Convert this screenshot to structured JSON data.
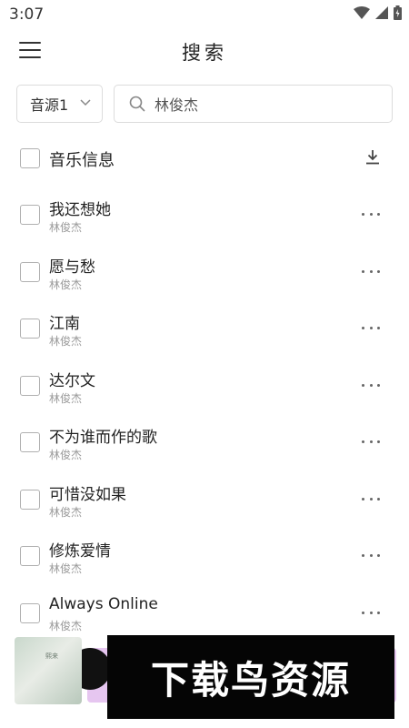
{
  "status_bar": {
    "time": "3:07"
  },
  "header": {
    "title": "搜索"
  },
  "search": {
    "source_label": "音源1",
    "query": "林俊杰"
  },
  "list_header": {
    "label": "音乐信息"
  },
  "songs": [
    {
      "title": "我还想她",
      "artist": "林俊杰"
    },
    {
      "title": "愿与愁",
      "artist": "林俊杰"
    },
    {
      "title": "江南",
      "artist": "林俊杰"
    },
    {
      "title": "达尔文",
      "artist": "林俊杰"
    },
    {
      "title": "不为谁而作的歌",
      "artist": "林俊杰"
    },
    {
      "title": "可惜没如果",
      "artist": "林俊杰"
    },
    {
      "title": "修炼爱情",
      "artist": "林俊杰"
    },
    {
      "title": "Always Online",
      "artist": "林俊杰"
    }
  ],
  "player": {
    "cover_text": "熙来"
  },
  "watermark": {
    "text": "下载鸟资源"
  },
  "colors": {
    "accent": "#e6c6f0",
    "watermark_bg": "#050505",
    "muted_text": "#999999"
  }
}
